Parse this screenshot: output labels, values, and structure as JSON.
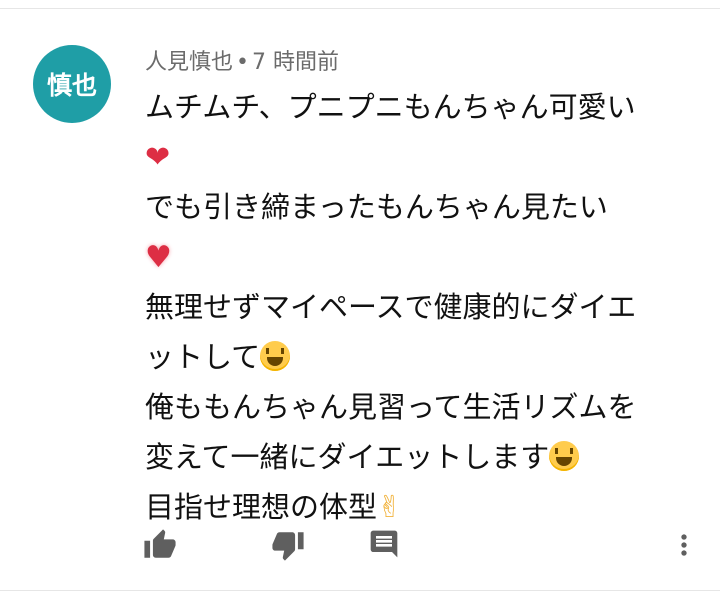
{
  "comment": {
    "avatar_text": "慎也",
    "author": "人見慎也",
    "separator": "•",
    "time": "7 時間前",
    "lines": [
      {
        "text": "ムチムチ、プニプニもんちゃん可愛い",
        "emoji": ""
      },
      {
        "text": "",
        "emoji": "❤"
      },
      {
        "text": "でも引き締まったもんちゃん見たい",
        "emoji": ""
      },
      {
        "text": "",
        "emoji": "💖"
      },
      {
        "text": "無理せずマイペースで健康的にダイエ",
        "emoji": ""
      },
      {
        "text": "ットして",
        "emoji": "😆"
      },
      {
        "text": "俺ももんちゃん見習って生活リズムを",
        "emoji": ""
      },
      {
        "text": "変えて一緒にダイエットします",
        "emoji": "😆"
      },
      {
        "text": "目指せ理想の体型",
        "emoji": "✌"
      }
    ]
  },
  "actions": {
    "icons": [
      "thumb-up-icon",
      "thumb-down-icon",
      "reply-icon",
      "more-vert-icon"
    ]
  },
  "colors": {
    "avatar_bg": "#1f9ea6",
    "meta_text": "#6b6b6b",
    "body_text": "#111111",
    "icon": "#5f5f5f"
  }
}
